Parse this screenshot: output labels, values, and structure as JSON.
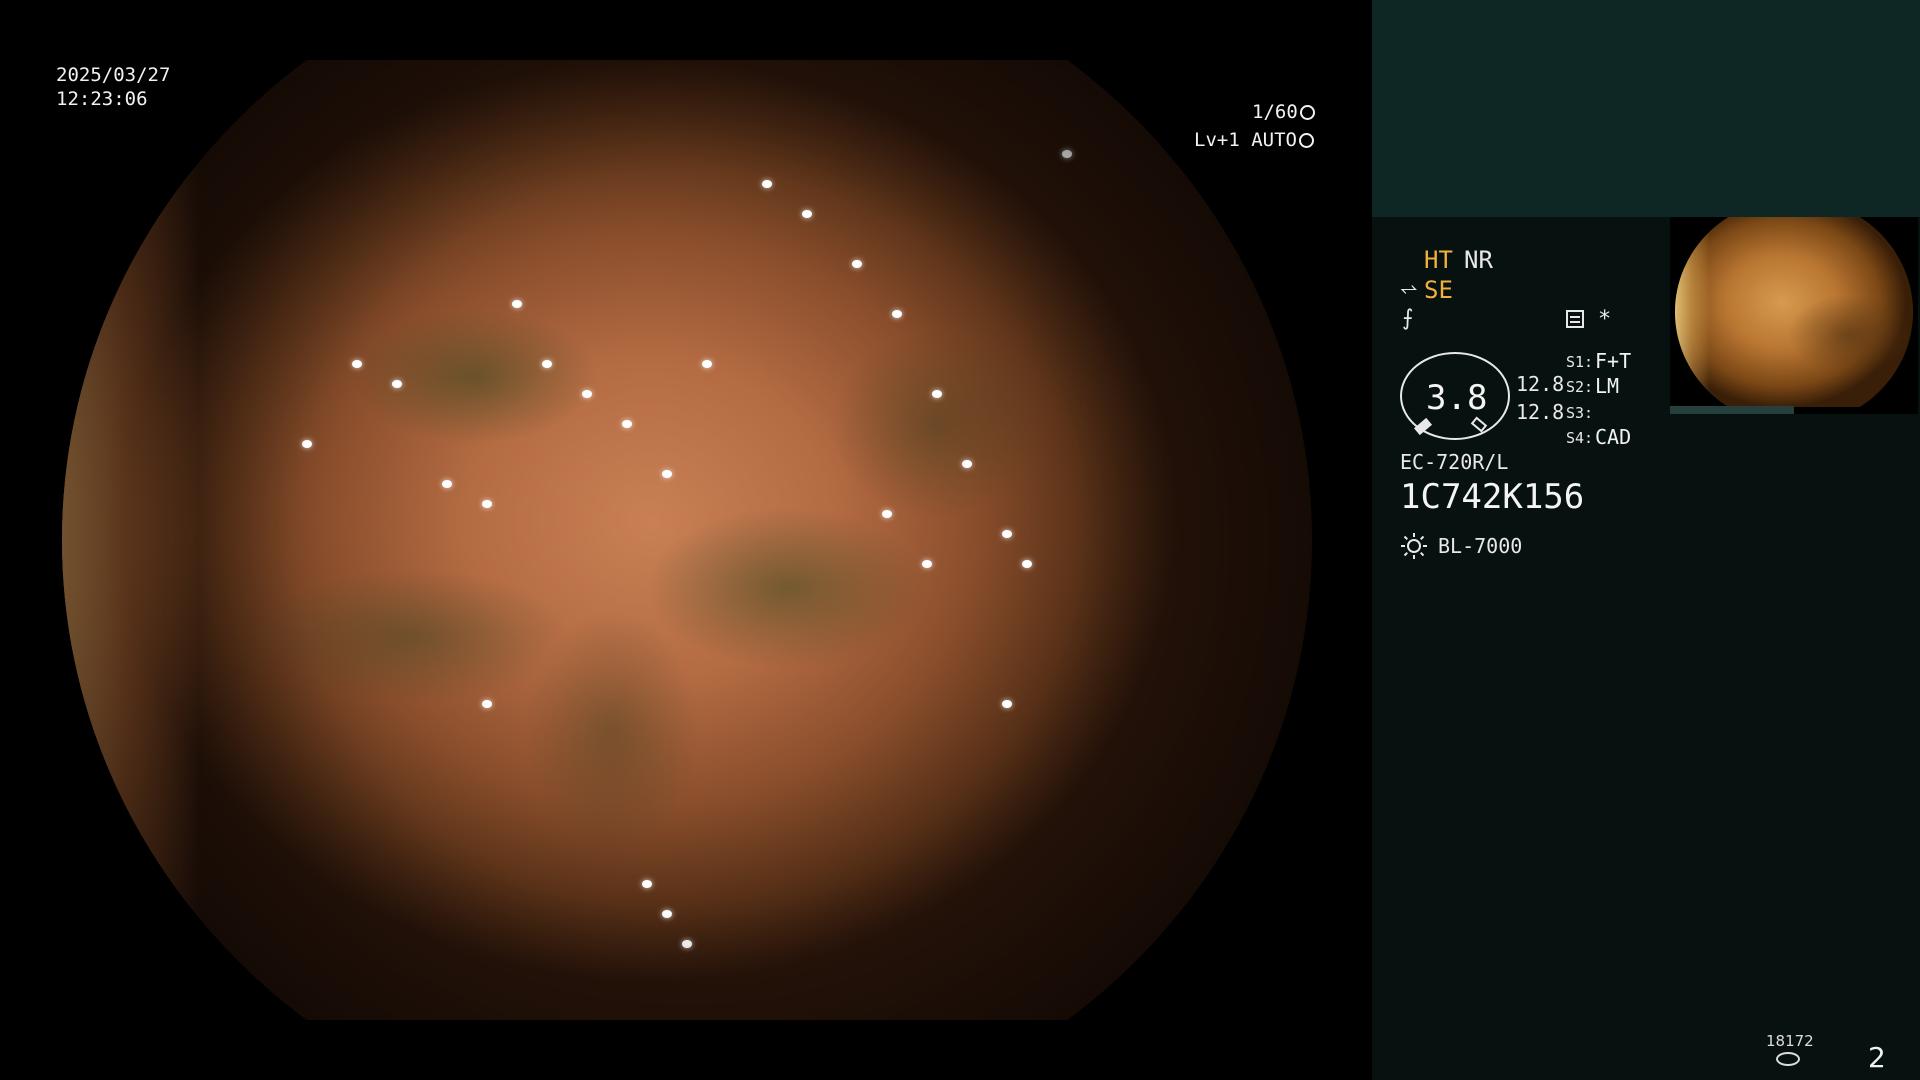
{
  "overlay": {
    "date": "2025/03/27",
    "time": "12:23:06",
    "shutter": "1/60",
    "level": "Lv+1 AUTO"
  },
  "panel": {
    "ht": "HT",
    "nr": "NR",
    "se": "SE",
    "star": "*",
    "oval_value": "3.8",
    "value_1": "12.8",
    "value_2": "12.8",
    "settings": [
      {
        "label": "S1:",
        "value": "F+T"
      },
      {
        "label": "S2:",
        "value": "LM"
      },
      {
        "label": "S3:",
        "value": ""
      },
      {
        "label": "S4:",
        "value": "CAD"
      }
    ],
    "scope_model": "EC-720R/L",
    "serial": "1C742K156",
    "light_source": "BL-7000",
    "counter": "18172",
    "page_number": "2"
  },
  "colors": {
    "panel_top": "#0e2725",
    "panel_bottom": "#07110f",
    "accent_orange": "#f2b03c"
  },
  "icons": [
    "shutter-icon",
    "auto-iris-icon",
    "structure-enhance-icon",
    "color-mode-icon",
    "settings-list-icon",
    "light-source-sun-icon",
    "storage-disk-icon"
  ]
}
